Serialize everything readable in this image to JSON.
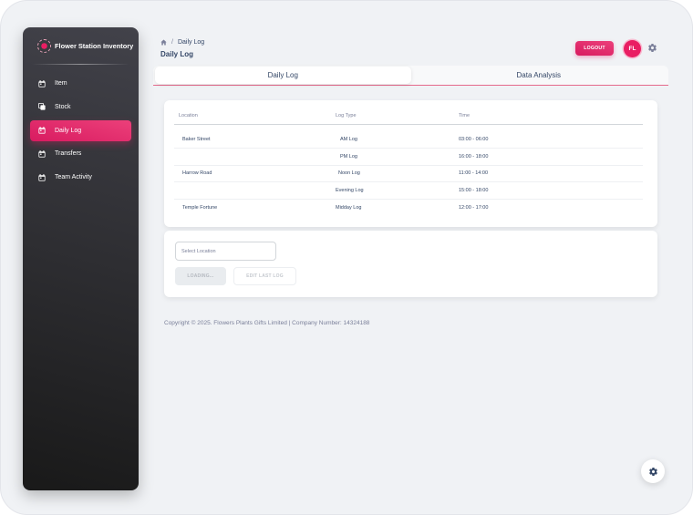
{
  "app": {
    "name": "Flower Station Inventory"
  },
  "sidebar": {
    "items": [
      {
        "label": "Item",
        "icon": "calendar-icon",
        "active": false
      },
      {
        "label": "Stock",
        "icon": "copy-icon",
        "active": false
      },
      {
        "label": "Daily Log",
        "icon": "calendar-icon",
        "active": true
      },
      {
        "label": "Transfers",
        "icon": "calendar-icon",
        "active": false
      },
      {
        "label": "Team Activity",
        "icon": "calendar-icon",
        "active": false
      }
    ]
  },
  "header": {
    "breadcrumb": "Daily Log",
    "title": "Daily Log",
    "logout_label": "LOGOUT",
    "avatar_initials": "FL"
  },
  "tabs": [
    {
      "label": "Daily Log",
      "active": true
    },
    {
      "label": "Data Analysis",
      "active": false
    }
  ],
  "log_table": {
    "columns": [
      "Location",
      "Log Type",
      "Time"
    ],
    "rows": [
      {
        "location": "Baker Street",
        "type": "AM Log",
        "time": "03:00 - 06:00"
      },
      {
        "location": "",
        "type": "PM Log",
        "time": "16:00 - 18:00"
      },
      {
        "location": "Harrow Road",
        "type": "Noon Log",
        "time": "11:00 - 14:00"
      },
      {
        "location": "",
        "type": "Evening Log",
        "time": "15:00 - 18:00"
      },
      {
        "location": "Temple Fortune",
        "type": "Midday Log",
        "time": "12:00 - 17:00"
      }
    ]
  },
  "form": {
    "location_placeholder": "Select Location",
    "loading_label": "LOADING...",
    "edit_label": "EDIT LAST LOG"
  },
  "footer": {
    "text": "Copyright © 2025. Flowers Plants Gifts Limited | Company Number: 14324188"
  },
  "colors": {
    "accent": "#e91e63",
    "sidebar_dark": "#191919",
    "text": "#344767",
    "muted": "#7b809a"
  }
}
